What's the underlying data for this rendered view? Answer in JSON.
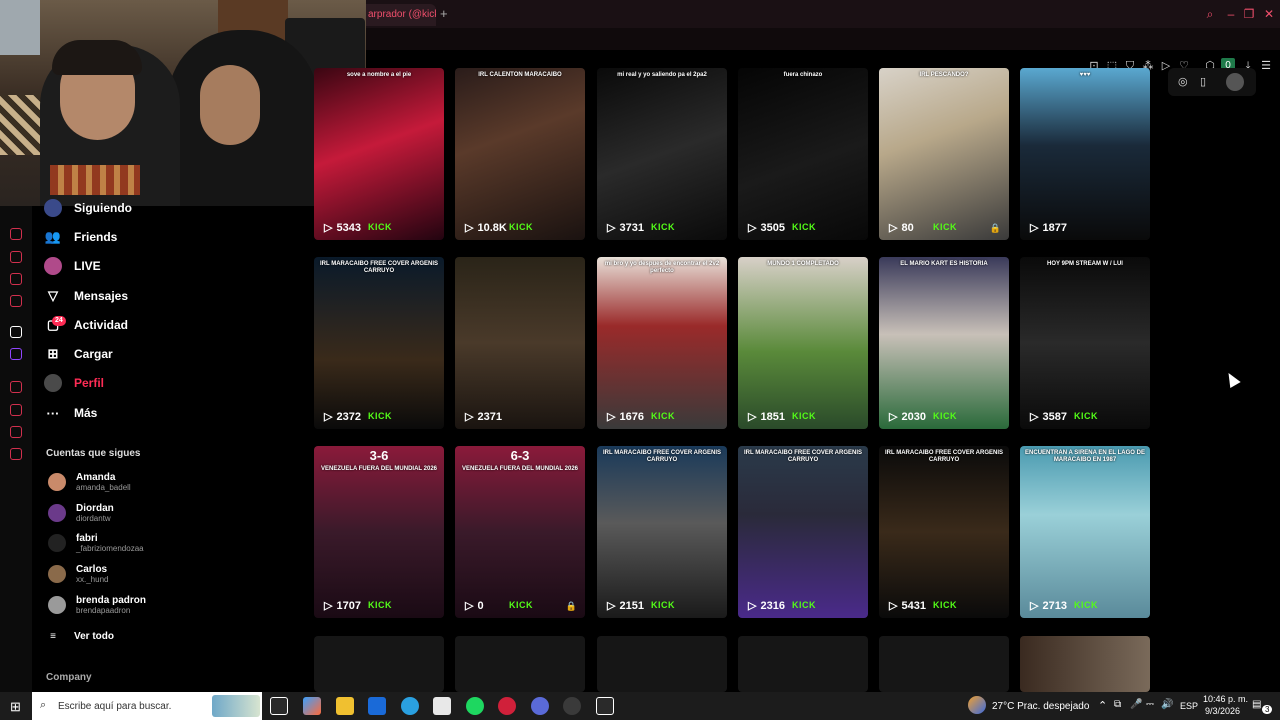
{
  "browser": {
    "tab_title": "arprador (@kick",
    "new_tab": "+",
    "badge_count": "0"
  },
  "nav": {
    "items": [
      {
        "label": "Siguiendo",
        "icon": "avatar-icon"
      },
      {
        "label": "Friends",
        "icon": "friends-icon"
      },
      {
        "label": "LIVE",
        "icon": "live-icon"
      },
      {
        "label": "Mensajes",
        "icon": "messages-icon"
      },
      {
        "label": "Actividad",
        "icon": "activity-icon",
        "badge": "24"
      },
      {
        "label": "Cargar",
        "icon": "upload-icon"
      },
      {
        "label": "Perfil",
        "icon": "profile-icon"
      },
      {
        "label": "Más",
        "icon": "more-icon"
      }
    ],
    "following_title": "Cuentas que sigues",
    "following": [
      {
        "name": "Amanda",
        "handle": "amanda_badell",
        "color": "#c98a6a"
      },
      {
        "name": "Diordan",
        "handle": "diordantw",
        "color": "#6b3a8a"
      },
      {
        "name": "fabri",
        "handle": "_fabriziomendozaa",
        "color": "#222222"
      },
      {
        "name": "Carlos",
        "handle": "xx._hund",
        "color": "#8a6a4a"
      },
      {
        "name": "brenda padron",
        "handle": "brendapaadron",
        "color": "#9a9a9a"
      }
    ],
    "see_all": "Ver todo",
    "company": "Company",
    "accent": "#fe2c55"
  },
  "videos": [
    {
      "caption": "sove a nombre a el pie",
      "views": "5343",
      "kick": "KICK",
      "bg": "linear-gradient(160deg,#3a0612,#c51a3a 45%,#220410)"
    },
    {
      "caption": "IRL CALENTON MARACAIBO",
      "views": "10.8K",
      "kick": "KICK",
      "bg": "linear-gradient(160deg,#2a1c1a,#5a3a2a 40%,#1a1210)"
    },
    {
      "caption": "mi real y yo saliendo pa el 2pa2",
      "views": "3731",
      "kick": "KICK",
      "bg": "linear-gradient(160deg,#0a0a0a,#2a2a2a 50%,#0a0a0a)"
    },
    {
      "caption": "fuera chinazo",
      "views": "3505",
      "kick": "KICK",
      "bg": "linear-gradient(160deg,#050505,#1a1a1a 55%,#080808)"
    },
    {
      "caption": "IRL PESCANDO?",
      "views": "80",
      "kick": "KICK",
      "lock": true,
      "bg": "linear-gradient(160deg,#d8d2c8,#b8a88a 40%,#3a3a3a)"
    },
    {
      "caption": "♥♥♥",
      "views": "1877",
      "kick": "",
      "bg": "linear-gradient(180deg,#5aa8d0,#1a2a3a 45%,#0a0a0a)"
    },
    {
      "caption": "IRL MARACAIBO FREE COVER ARGENIS CARRUYO",
      "views": "2372",
      "kick": "KICK",
      "bg": "linear-gradient(180deg,#0a1a2a,#3a2a1a 60%,#0a0a0a)"
    },
    {
      "caption": "",
      "views": "2371",
      "kick": "",
      "bg": "linear-gradient(180deg,#2a2418,#4a3a2a 50%,#1a1410)"
    },
    {
      "caption": "mi bro y yo despues de encontrar el 2v2 perfecto",
      "views": "1676",
      "kick": "KICK",
      "bg": "linear-gradient(180deg,#e8e0d8,#9a2a2a 40%,#3a3a3a)"
    },
    {
      "caption": "MUNDO 1 COMPLETADO",
      "views": "1851",
      "kick": "KICK",
      "bg": "linear-gradient(180deg,#d8d0c8,#5a8a3a 55%,#2a4a2a)"
    },
    {
      "caption": "EL MARIO KART ES HISTORIA",
      "views": "2030",
      "kick": "KICK",
      "bg": "linear-gradient(180deg,#3a3a5a,#c8c0b8 45%,#2a6a3a)"
    },
    {
      "caption": "HOY 9PM STREAM W / LUI",
      "views": "3587",
      "kick": "KICK",
      "bg": "linear-gradient(180deg,#0a0a0a,#2a2a2a 50%,#0a0a0a)"
    },
    {
      "caption": "VENEZUELA FUERA DEL MUNDIAL 2026",
      "score": "3-6",
      "views": "1707",
      "kick": "KICK",
      "bg": "linear-gradient(180deg,#8a1a3a,#3a1a2a 50%,#1a0a14)"
    },
    {
      "caption": "VENEZUELA FUERA DEL MUNDIAL 2026",
      "score": "6-3",
      "views": "0",
      "kick": "KICK",
      "lock": true,
      "bg": "linear-gradient(180deg,#8a1a3a,#3a1a2a 50%,#1a0a14)"
    },
    {
      "caption": "IRL MARACAIBO FREE COVER ARGENIS CARRUYO",
      "views": "2151",
      "kick": "KICK",
      "bg": "linear-gradient(180deg,#1a3a5a,#5a5a5a 45%,#1a1a1a)"
    },
    {
      "caption": "IRL MARACAIBO FREE COVER ARGENIS CARRUYO",
      "views": "2316",
      "kick": "KICK",
      "bg": "linear-gradient(180deg,#2a3a4a,#2a2a3a 40%,#4a2a8a)"
    },
    {
      "caption": "IRL MARACAIBO FREE COVER ARGENIS CARRUYO",
      "views": "5431",
      "kick": "KICK",
      "bg": "linear-gradient(180deg,#0a0a0a,#3a2a1a 50%,#0a0a0a)"
    },
    {
      "caption": "ENCUENTRAN A SIRENA EN EL LAGO DE MARACAIBO EN 1987",
      "views": "2713",
      "kick": "KICK",
      "bg": "linear-gradient(180deg,#4a9ab0,#9ad0d8 40%,#5a8a9a)"
    }
  ],
  "taskbar": {
    "search_placeholder": "Escribe aquí para buscar.",
    "weather": "27°C  Prac. despejado",
    "lang": "ESP",
    "time": "10:46 p. m.",
    "date": "9/3/2026",
    "notif_count": "3"
  }
}
